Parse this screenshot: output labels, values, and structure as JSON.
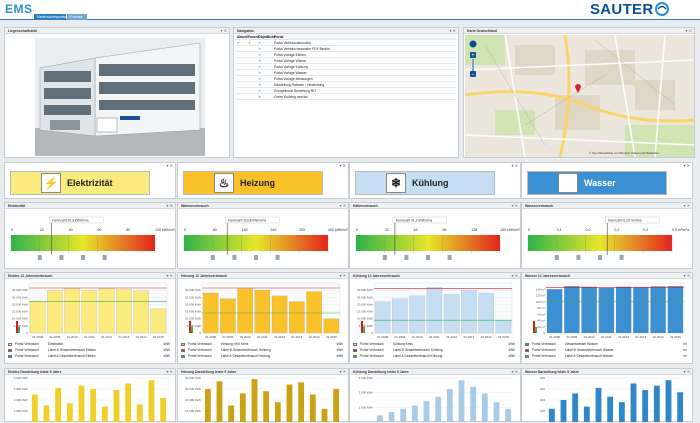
{
  "header": {
    "app_logo": "EMS",
    "brand": "SAUTER",
    "tabs": [
      "Verbrauchsportal",
      "Portale"
    ],
    "accent": "#2b7fc3"
  },
  "panels": {
    "photo_title": "Liegenschaftsbild",
    "nav_title": "Navigation",
    "map_title": "Karte Deutschland",
    "map_attribution": "© OpenStreetMap contributors, Daten und Stadtplan"
  },
  "navigation": {
    "columns": [
      "Aktuell",
      "Favorit",
      "Objekt",
      "Sicht",
      "Portal"
    ],
    "items": [
      {
        "label": "Portal Verbrauchsmonitor",
        "current": true,
        "fav": true
      },
      {
        "label": "Portal Verbrauchsmonitor PDF Bericht",
        "current": false,
        "fav": false
      },
      {
        "label": "Portal Vorlage Elektro",
        "current": false,
        "fav": false
      },
      {
        "label": "Portal Vorlage Wärme",
        "current": false,
        "fav": false
      },
      {
        "label": "Portal Vorlage Kühlung",
        "current": false,
        "fav": false
      },
      {
        "label": "Portal Vorlage Wasser",
        "current": false,
        "fav": false
      },
      {
        "label": "Portal Vorlage Messungen",
        "current": false,
        "fav": false
      },
      {
        "label": "Darstellung Rahmen / Verdichtung",
        "current": false,
        "fav": false
      },
      {
        "label": "Energetische Bewertung RLT",
        "current": false,
        "fav": false
      },
      {
        "label": "Green Building monitor",
        "current": false,
        "fav": false
      }
    ]
  },
  "categories": [
    {
      "label": "Elektrizität",
      "icon": "lightning-icon",
      "color": "#fbea7d",
      "glyph": "⚡"
    },
    {
      "label": "Heizung",
      "icon": "heating-icon",
      "color": "#fbc12b",
      "glyph": "♨"
    },
    {
      "label": "Kühlung",
      "icon": "snowflake-icon",
      "color": "#c6def4",
      "glyph": "❄"
    },
    {
      "label": "Wasser",
      "icon": "water-icon",
      "color": "#3c8fd0",
      "glyph": "≋"
    }
  ],
  "gauges": [
    {
      "title": "Elektrizität",
      "ticks": [
        "0",
        "20",
        "40",
        "60",
        "80",
        "100 kWh/m²a"
      ],
      "needle": 0.28,
      "readout": "Kennzahl 20,2 kWh/m²a"
    },
    {
      "title": "Wärmeverbrauch",
      "ticks": [
        "0",
        "80",
        "160",
        "240",
        "320",
        "400 kWh/m²a"
      ],
      "needle": 0.3,
      "readout": "Kennzahl 119,8 kWh/m²a"
    },
    {
      "title": "Kälteverbrauch",
      "ticks": [
        "0",
        "32",
        "64",
        "96",
        "128",
        "160 kWh/m²a"
      ],
      "needle": 0.27,
      "readout": "Kennzahl 41,2 kWh/m²a"
    },
    {
      "title": "Wasserverbrauch",
      "ticks": [
        "0",
        "0,1",
        "0,2",
        "0,3",
        "0,4",
        "0,5 m³/m²a"
      ],
      "needle": 0.55,
      "readout": "Kennzahl 0,23 m³/m²a"
    }
  ],
  "chart_data": [
    {
      "type": "bar",
      "title": "Elektro 12 Jahresverbrauch",
      "categories": [
        "01.2008",
        "01.2009",
        "01.2010",
        "01.2011",
        "01.2012",
        "01.2013",
        "01.2014",
        "01.2015"
      ],
      "values": [
        22000,
        30000,
        31000,
        30000,
        31000,
        30500,
        29500,
        17000
      ],
      "ylim": [
        0,
        35000
      ],
      "yticks": [
        "0",
        "5.000 kWh",
        "10.000 kWh",
        "15.000 kWh",
        "20.000 kWh",
        "25.000 kWh",
        "30.000 kWh"
      ],
      "color": "#fbea7d",
      "limit_top": 31500,
      "limit_bottom": 22000,
      "legend": [
        {
          "name": "Portal Verbrauch",
          "unit": "Elektrizität",
          "suffix": "kWh",
          "color": "#fbea7d"
        },
        {
          "name": "Portal Verbrauch",
          "unit": "Label B Gesamtverbrauch Elektro",
          "suffix": "kWh",
          "color": "#d81b20"
        },
        {
          "name": "Portal Verbrauch",
          "unit": "Label A Gesamtverbrauch Elektro",
          "suffix": "kWh",
          "color": "#35b34a"
        }
      ]
    },
    {
      "type": "bar",
      "title": "Heizung 12 Jahresverbrauch",
      "categories": [
        "01.2008",
        "01.2009",
        "01.2010",
        "01.2011",
        "01.2012",
        "01.2013",
        "01.2014",
        "01.2015"
      ],
      "values": [
        28000,
        24000,
        31000,
        30000,
        26000,
        22000,
        29000,
        10000
      ],
      "ylim": [
        0,
        35000
      ],
      "yticks": [
        "0",
        "5.000 kWh",
        "10.000 kWh",
        "15.000 kWh",
        "20.000 kWh",
        "25.000 kWh",
        "30.000 kWh"
      ],
      "color": "#fbc12b",
      "limit_top": 31500,
      "limit_bottom": 14000,
      "legend": [
        {
          "name": "Portal Verbrauch",
          "unit": "Heizung HKV Kreis",
          "suffix": "kWh",
          "color": "#fbc12b"
        },
        {
          "name": "Portal Verbrauch",
          "unit": "Label B Gesamtverbrauch Heizung",
          "suffix": "kWh",
          "color": "#d81b20"
        },
        {
          "name": "Portal Verbrauch",
          "unit": "Label A Gesamtverbrauch Heizung",
          "suffix": "kWh",
          "color": "#35b34a"
        }
      ]
    },
    {
      "type": "bar",
      "title": "Kühlung 12 Jahresverbrauch",
      "categories": [
        "01.2008",
        "01.2009",
        "01.2010",
        "01.2011",
        "01.2012",
        "01.2013",
        "01.2014",
        "01.2015"
      ],
      "values": [
        22000,
        24000,
        26000,
        32000,
        27000,
        30000,
        28000,
        9000
      ],
      "ylim": [
        0,
        35000
      ],
      "yticks": [
        "0",
        "5.000 kWh",
        "10.000 kWh",
        "15.000 kWh",
        "20.000 kWh",
        "25.000 kWh",
        "30.000 kWh"
      ],
      "color": "#c6def4",
      "limit_top": 31000,
      "limit_bottom": 9000,
      "legend": [
        {
          "name": "Portal Verbrauch",
          "unit": "Kühlung Kreis",
          "suffix": "kWh",
          "color": "#c6def4"
        },
        {
          "name": "Portal Verbrauch",
          "unit": "Label B Gesamtverbrauch Kühlung",
          "suffix": "kWh",
          "color": "#d81b20"
        },
        {
          "name": "Portal Verbrauch",
          "unit": "Label A Gesamtverbrauch Kühlung",
          "suffix": "kWh",
          "color": "#35b34a"
        }
      ]
    },
    {
      "type": "bar",
      "title": "Wasser 12 Jahresverbrauch",
      "categories": [
        "01.2008",
        "01.2009",
        "01.2010",
        "01.2011",
        "01.2012",
        "01.2013",
        "01.2014",
        "01.2015"
      ],
      "values": [
        140,
        150,
        148,
        145,
        148,
        147,
        149,
        150
      ],
      "ylim": [
        0,
        160
      ],
      "yticks": [
        "0",
        "20 m³",
        "40 m³",
        "60 m³",
        "80 m³",
        "100 m³",
        "120 m³",
        "140 m³"
      ],
      "color": "#3c8fd0",
      "limit_top": 145,
      "limit_bottom": 100,
      "legend": [
        {
          "name": "Portal Verbrauch",
          "unit": "Gesamtwasser Wasser",
          "suffix": "m³",
          "color": "#3c8fd0"
        },
        {
          "name": "Portal Verbrauch",
          "unit": "Label B Gesamtverbrauch Wasser",
          "suffix": "m³",
          "color": "#d81b20"
        },
        {
          "name": "Portal Verbrauch",
          "unit": "Label A Gesamtverbrauch Wasser",
          "suffix": "m³",
          "color": "#35b34a"
        }
      ]
    },
    {
      "type": "bar",
      "title": "Elektro Darstellung letzte 5 Jahre",
      "values": [
        2500,
        1500,
        3100,
        1700,
        3300,
        3000,
        1400,
        2900,
        3500,
        1600,
        3800,
        2200
      ],
      "ylim": [
        0,
        4000
      ],
      "yticks": [
        "1.000 kWh",
        "2.000 kWh",
        "3.000 kWh",
        "4.000 kWh"
      ],
      "color": "#f0cf2a"
    },
    {
      "type": "bar",
      "title": "Heizung Darstellung letzte 5 Jahre",
      "values": [
        3000,
        3700,
        1500,
        2600,
        3900,
        2800,
        1800,
        3400,
        3600,
        2500,
        1200,
        3000
      ],
      "ylim": [
        0,
        4000
      ],
      "yticks": [
        "10.000 kWh",
        "20.000 kWh",
        "30.000 kWh",
        "40.000 kWh"
      ],
      "color": "#c9a216"
    },
    {
      "type": "bar",
      "title": "Kühlung Darstellung letzte 5 Jahre",
      "values": [
        600,
        900,
        1200,
        1500,
        1900,
        2300,
        3000,
        3800,
        3200,
        2600,
        1800,
        1200
      ],
      "ylim": [
        0,
        4000
      ],
      "yticks": [
        "1.000 kWh",
        "2.000 kWh",
        "3.000 kWh"
      ],
      "color": "#a8cbe8"
    },
    {
      "type": "bar",
      "title": "Wasser Darstellung letzte 5 Jahre",
      "values": [
        1200,
        2000,
        2600,
        1400,
        3100,
        2300,
        1800,
        3500,
        2900,
        3300,
        3800,
        2700
      ],
      "ylim": [
        0,
        4000
      ],
      "yticks": [
        "100",
        "200",
        "300",
        "400"
      ],
      "color": "#2f86c9"
    }
  ]
}
